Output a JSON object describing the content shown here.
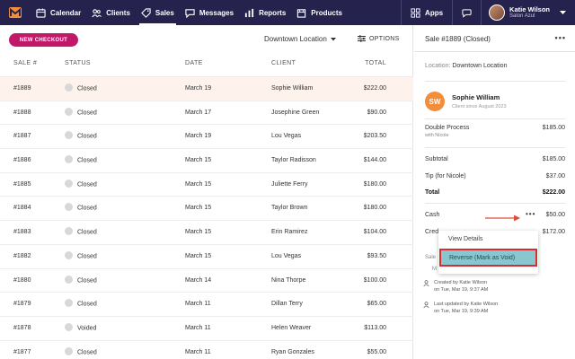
{
  "nav": {
    "items": [
      {
        "label": "Calendar",
        "icon": "calendar-icon"
      },
      {
        "label": "Clients",
        "icon": "clients-icon"
      },
      {
        "label": "Sales",
        "icon": "tag-icon",
        "active": true
      },
      {
        "label": "Messages",
        "icon": "chat-icon"
      },
      {
        "label": "Reports",
        "icon": "bar-chart-icon"
      },
      {
        "label": "Products",
        "icon": "box-icon"
      }
    ],
    "apps_label": "Apps",
    "user_name": "Katie Wilson",
    "user_org": "Salon Azul"
  },
  "toolbar": {
    "new_checkout": "NEW CHECKOUT",
    "location": "Downtown Location",
    "options": "OPTIONS"
  },
  "table": {
    "headers": {
      "sale": "SALE #",
      "status": "STATUS",
      "date": "DATE",
      "client": "CLIENT",
      "total": "TOTAL"
    },
    "rows": [
      {
        "sale": "#1889",
        "status": "Closed",
        "date": "March 19",
        "client": "Sophie William",
        "total": "$222.00",
        "selected": true
      },
      {
        "sale": "#1888",
        "status": "Closed",
        "date": "March 17",
        "client": "Josephine Green",
        "total": "$90.00"
      },
      {
        "sale": "#1887",
        "status": "Closed",
        "date": "March 19",
        "client": "Lou Vegas",
        "total": "$203.50"
      },
      {
        "sale": "#1886",
        "status": "Closed",
        "date": "March 15",
        "client": "Taylor Radisson",
        "total": "$144.00"
      },
      {
        "sale": "#1885",
        "status": "Closed",
        "date": "March 15",
        "client": "Juliette Ferry",
        "total": "$180.00"
      },
      {
        "sale": "#1884",
        "status": "Closed",
        "date": "March 15",
        "client": "Taylor Brown",
        "total": "$180.00"
      },
      {
        "sale": "#1883",
        "status": "Closed",
        "date": "March 15",
        "client": "Erin Ramirez",
        "total": "$104.00"
      },
      {
        "sale": "#1882",
        "status": "Closed",
        "date": "March 15",
        "client": "Lou Vegas",
        "total": "$93.50"
      },
      {
        "sale": "#1880",
        "status": "Closed",
        "date": "March 14",
        "client": "Nina Thorpe",
        "total": "$100.00"
      },
      {
        "sale": "#1879",
        "status": "Closed",
        "date": "March 11",
        "client": "Dillan Terry",
        "total": "$65.00"
      },
      {
        "sale": "#1878",
        "status": "Voided",
        "date": "March 11",
        "client": "Helen Weaver",
        "total": "$113.00"
      },
      {
        "sale": "#1877",
        "status": "Closed",
        "date": "March 11",
        "client": "Ryan Gonzales",
        "total": "$55.00"
      }
    ]
  },
  "detail": {
    "title": "Sale #1889 (Closed)",
    "location_label": "Location:",
    "location_value": "Downtown Location",
    "client_initials": "SW",
    "client_name": "Sophie William",
    "client_since": "Client since August 2023",
    "service_name": "Double Process",
    "service_staff": "with Nicole",
    "service_price": "$185.00",
    "subtotal_label": "Subtotal",
    "subtotal_value": "$185.00",
    "tip_label": "Tip (for Nicole)",
    "tip_value": "$37.00",
    "total_label": "Total",
    "total_value": "$222.00",
    "cash_label": "Cash",
    "cash_value": "$50.00",
    "credit_label_partial": "Cred",
    "credit_value": "$172.00",
    "sale_partial": "Sale",
    "marked_partial": "M",
    "created_by": "Created by Katie Wilson",
    "created_at": "on Tue, Mar 19, 9:37 AM",
    "updated_by": "Last updated by Katie Wilson",
    "updated_at": "on Tue, Mar 19, 9:39 AM"
  },
  "context_menu": {
    "view_details": "View Details",
    "reverse": "Reverse (Mark as Void)"
  },
  "colors": {
    "nav_bg": "#25234d",
    "brand_pink": "#c1186a",
    "selected_row": "#fdf3ec",
    "client_avatar": "#f28e3b",
    "highlight_fill": "#8ac6d0",
    "highlight_border": "#d62d2d",
    "arrow": "#e04b3c"
  }
}
